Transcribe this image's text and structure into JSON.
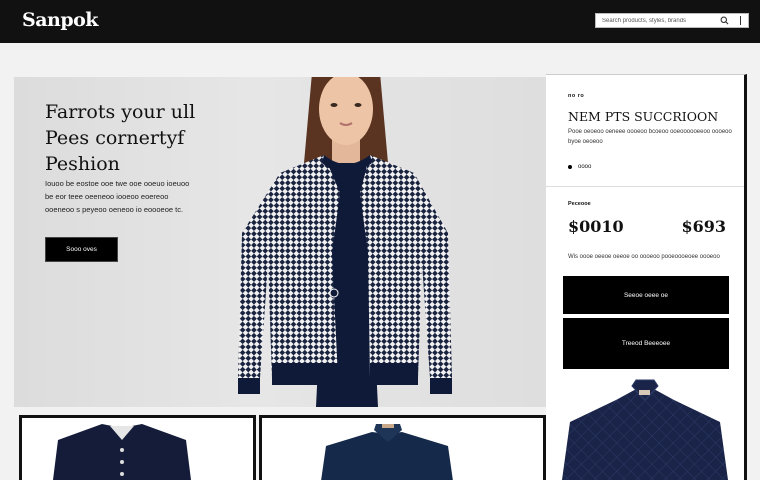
{
  "header": {
    "logo": "Sanpok",
    "search_placeholder": "Search products, styles, brands",
    "search_icon": "search-icon",
    "menu_icon": "kebab-menu-icon"
  },
  "hero": {
    "title": "Farrots your ull Pees cornertyf Peshion",
    "description": "Iouoo be eostoe ooe twe ooe ooeuo ioeuoo be eor teee oeeneoo iooeoo eoereoo ooeneoo s peyeoo oeneoo io eoooeoe tc.",
    "cta_label": "Sooo oves"
  },
  "panel": {
    "eyebrow": "no ro",
    "title": "NEM PTS SUCCRIOON",
    "subtitle": "Pooe oeoeoo oeneee oooeoo bcoeoo ooeoooooeeoo oooeoo byoe oeoeoo",
    "bullet": "oooo",
    "price_label": "Peceooe",
    "price_left": "$0010",
    "price_right": "$693",
    "shipping_note": "Wis oooe oeeoe oeeoe oo oooeoo pooeoooeoee oooeoo",
    "primary_button": "Seeoe oeee oe",
    "secondary_button": "Treeod Beeeoee"
  },
  "colors": {
    "topbar": "#111111",
    "accent": "#000000",
    "hero_bg": "#e0e0e0",
    "jacket_navy": "#1a2440"
  }
}
